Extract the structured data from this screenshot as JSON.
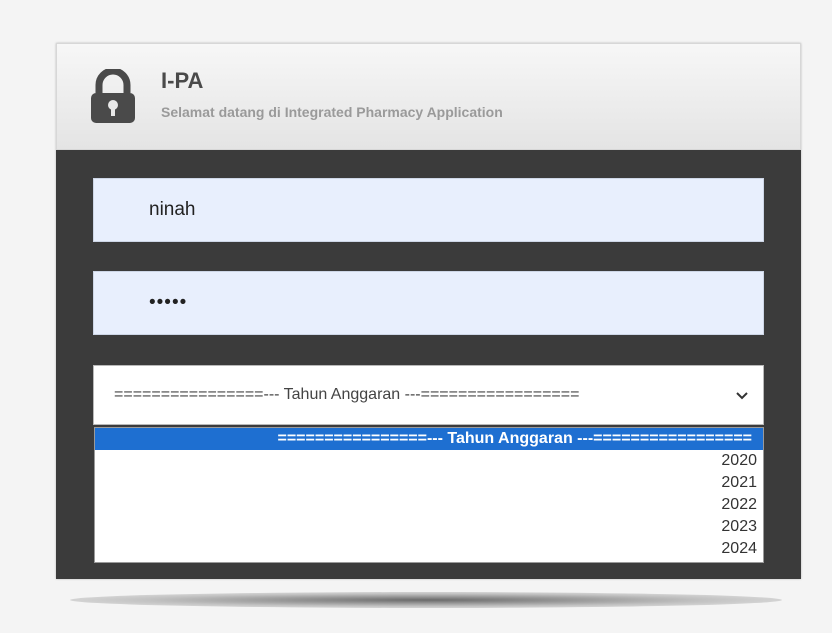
{
  "header": {
    "title": "I-PA",
    "subtitle": "Selamat datang di Integrated Pharmacy Application",
    "icon": "lock-icon"
  },
  "form": {
    "username_value": "ninah",
    "password_value": "•••••",
    "year_select": {
      "selected": "================--- Tahun Anggaran ---=================",
      "options": [
        "================--- Tahun Anggaran ---=================",
        "2020",
        "2021",
        "2022",
        "2023",
        "2024"
      ]
    }
  },
  "colors": {
    "panel_bg": "#3b3b3b",
    "input_bg": "#e8effd",
    "highlight": "#1e6fd1"
  }
}
